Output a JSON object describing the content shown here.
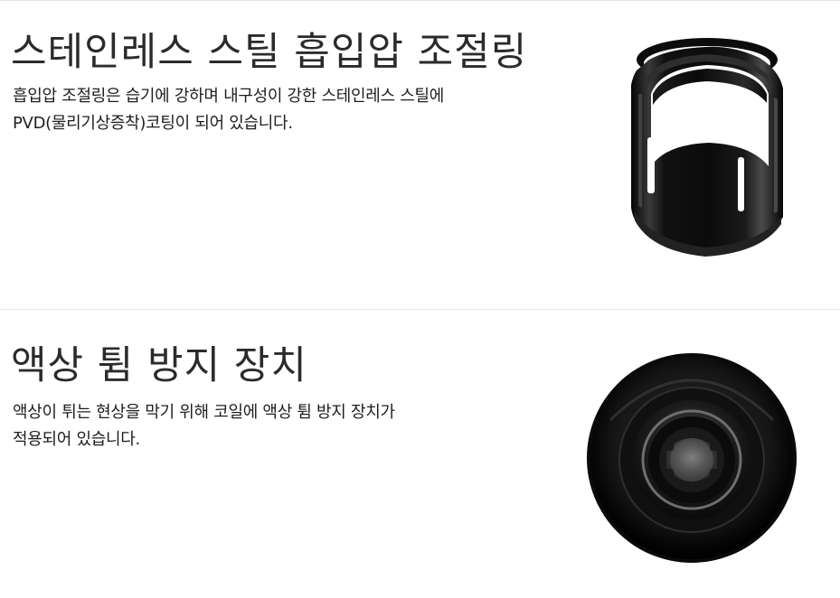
{
  "sections": [
    {
      "title": "스테인레스 스틸 흡입압 조절링",
      "description_lines": [
        "흡입압 조절링은 습기에 강하며 내구성이 강한 스테인레스 스틸에",
        "PVD(물리기상증착)코팅이 되어 있습니다."
      ],
      "image": "black-stainless-ring"
    },
    {
      "title": "액상 튐 방지 장치",
      "description_lines": [
        "액상이 튀는 현상을 막기 위해 코일에 액상 튐 방지 장치가",
        "적용되어 있습니다."
      ],
      "image": "black-anti-spitback-cap"
    }
  ],
  "colors": {
    "background": "#ffffff",
    "text": "#1e1e1e",
    "divider": "#e6e6e6",
    "product": "#111111"
  }
}
